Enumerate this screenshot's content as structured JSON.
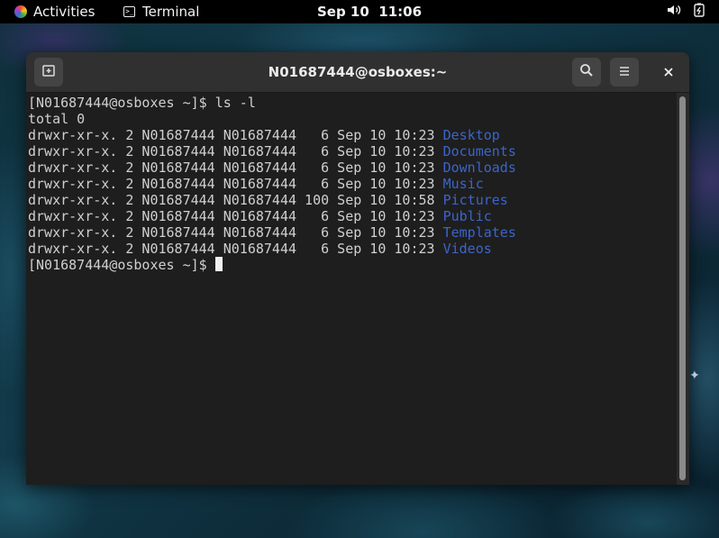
{
  "topbar": {
    "activities_label": "Activities",
    "app_name": "Terminal",
    "date": "Sep 10",
    "time": "11:06",
    "icons": [
      "volume-icon",
      "battery-icon"
    ]
  },
  "window": {
    "title": "N01687444@osboxes:~",
    "buttons": [
      "new-tab-icon",
      "search-icon",
      "hamburger-menu-icon",
      "close-icon"
    ]
  },
  "terminal": {
    "prompt": "[N01687444@osboxes ~]$ ",
    "command": "ls -l",
    "total_line": "total 0",
    "entries": [
      {
        "perms": "drwxr-xr-x. 2 N01687444 N01687444   6 Sep 10 10:23 ",
        "name": "Desktop"
      },
      {
        "perms": "drwxr-xr-x. 2 N01687444 N01687444   6 Sep 10 10:23 ",
        "name": "Documents"
      },
      {
        "perms": "drwxr-xr-x. 2 N01687444 N01687444   6 Sep 10 10:23 ",
        "name": "Downloads"
      },
      {
        "perms": "drwxr-xr-x. 2 N01687444 N01687444   6 Sep 10 10:23 ",
        "name": "Music"
      },
      {
        "perms": "drwxr-xr-x. 2 N01687444 N01687444 100 Sep 10 10:58 ",
        "name": "Pictures"
      },
      {
        "perms": "drwxr-xr-x. 2 N01687444 N01687444   6 Sep 10 10:23 ",
        "name": "Public"
      },
      {
        "perms": "drwxr-xr-x. 2 N01687444 N01687444   6 Sep 10 10:23 ",
        "name": "Templates"
      },
      {
        "perms": "drwxr-xr-x. 2 N01687444 N01687444   6 Sep 10 10:23 ",
        "name": "Videos"
      }
    ],
    "final_prompt": "[N01687444@osboxes ~]$ "
  },
  "colors": {
    "directory": "#3b65c9",
    "text": "#d0d0d0",
    "background": "#1e1e1e"
  }
}
